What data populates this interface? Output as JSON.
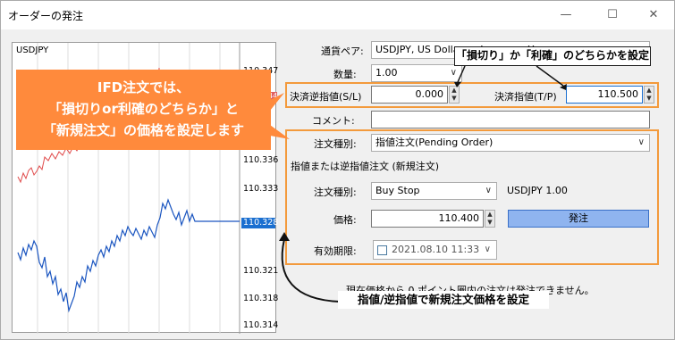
{
  "window": {
    "title": "オーダーの発注",
    "minimize_icon": "minimize-icon",
    "maximize_icon": "maximize-icon",
    "close_icon": "close-icon"
  },
  "chart": {
    "symbol": "USDJPY",
    "price_labels": [
      "110.347",
      "110.336",
      "110.333",
      "110.328",
      "110.321",
      "110.318",
      "110.314"
    ],
    "current_price": "110.328",
    "red_marker": "44"
  },
  "form": {
    "symbol_label": "通貨ペア:",
    "symbol_value": "USDJPY, US Dollar vs Japanese Yen",
    "volume_label": "数量:",
    "volume_value": "1.00",
    "sl_label": "決済逆指値(S/L)",
    "sl_value": "0.000",
    "tp_label": "決済指値(T/P)",
    "tp_value": "110.500",
    "comment_label": "コメント:",
    "comment_value": "",
    "order_type_label": "注文種別:",
    "order_type_value": "指値注文(Pending Order)",
    "section_title": "指値または逆指値注文 (新規注文)",
    "pending_type_label": "注文種別:",
    "pending_type_value": "Buy Stop",
    "pending_info": "USDJPY 1.00",
    "price_label": "価格:",
    "price_value": "110.400",
    "order_button": "発注",
    "expiry_label": "有効期限:",
    "expiry_value": "2021.08.10 11:33",
    "note": "現在価格から 0 ポイント圏内の注文は発注できません。"
  },
  "callouts": {
    "main_line1": "IFD注文では、",
    "main_line2": "「損切りor利確のどちらか」と",
    "main_line3": "「新規注文」の価格を設定します",
    "top": "「損切り」か「利確」のどちらかを設定",
    "bottom": "指値/逆指値で新規注文価格を設定"
  },
  "colors": {
    "accent_orange": "#ff8a3c",
    "box_orange": "#f39a3c",
    "order_button": "#8fb4ef",
    "price_line": "#1a6fd0"
  }
}
